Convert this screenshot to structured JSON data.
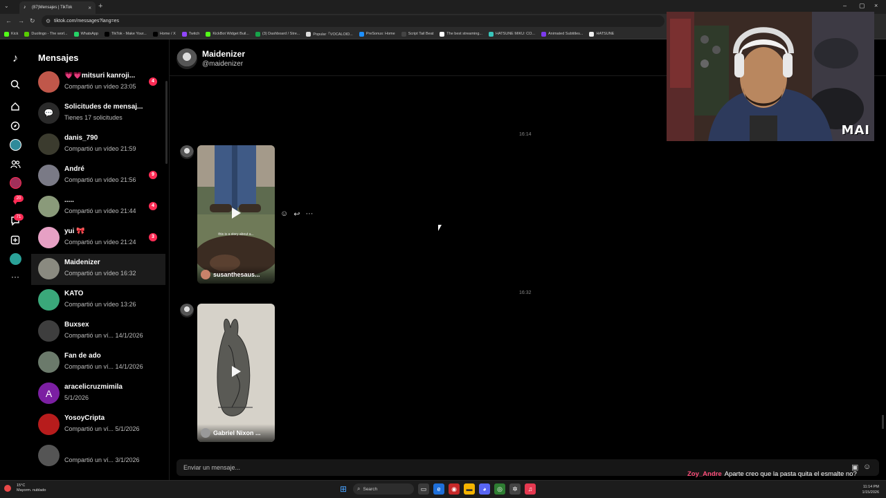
{
  "browser": {
    "tab_title": "(87)Mensajes | TikTok",
    "url": "tiktok.com/messages?lang=es",
    "bookmarks": [
      {
        "label": "Kick",
        "color": "#53fc18"
      },
      {
        "label": "Duolingo - The worl...",
        "color": "#58cc02"
      },
      {
        "label": "WhatsApp",
        "color": "#25d366"
      },
      {
        "label": "TikTok - Make Your...",
        "color": "#000000"
      },
      {
        "label": "Home / X",
        "color": "#000000"
      },
      {
        "label": "Twitch",
        "color": "#9146ff"
      },
      {
        "label": "KickBot Widget Buil...",
        "color": "#53fc18"
      },
      {
        "label": "(3) Dashboard / Stre...",
        "color": "#16a34a"
      },
      {
        "label": "Popular「VOCALOID...",
        "color": "#dddddd"
      },
      {
        "label": "PreSonus: Home",
        "color": "#1e90ff"
      },
      {
        "label": "Script Tail Beat",
        "color": "#444444"
      },
      {
        "label": "The best streaming...",
        "color": "#ffffff"
      },
      {
        "label": "HATSUNE MIKU: CO...",
        "color": "#39c5bb"
      },
      {
        "label": "Animated Subtitles...",
        "color": "#7c3aed"
      },
      {
        "label": "HATSUNE",
        "color": "#eeeeee"
      }
    ]
  },
  "rail": {
    "badges": {
      "heart": "20",
      "inbox": "71"
    }
  },
  "sidebar": {
    "title": "Mensajes",
    "conversations": [
      {
        "name": "💗💗mitsuri kanroji...",
        "sub": "Compartió un vídeo 23:05",
        "badge": "4",
        "color": "#c0574a"
      },
      {
        "name": "Solicitudes de mensaj...",
        "sub": "Tienes 17 solicitudes",
        "badge": "",
        "color": "#2a2a2a"
      },
      {
        "name": "danis_790",
        "sub": "Compartió un vídeo 21:59",
        "badge": "",
        "color": "#3b3b2e"
      },
      {
        "name": "André",
        "sub": "Compartió un vídeo 21:56",
        "badge": "9",
        "color": "#7a7a86"
      },
      {
        "name": ".....",
        "sub": "Compartió un vídeo 21:44",
        "badge": "4",
        "color": "#8a9a7a"
      },
      {
        "name": "yui 🎀",
        "sub": "Compartió un vídeo 21:24",
        "badge": "3",
        "color": "#e6a0c4"
      },
      {
        "name": "Maidenizer",
        "sub": "Compartió un vídeo 16:32",
        "badge": "",
        "color": "#8a8a80"
      },
      {
        "name": "KATO",
        "sub": "Compartió un vídeo 13:26",
        "badge": "",
        "color": "#3aa87a"
      },
      {
        "name": "Buxsex",
        "sub": "Compartió un ví... 14/1/2026",
        "badge": "",
        "color": "#3e3e3e"
      },
      {
        "name": "Fan de ado",
        "sub": "Compartió un ví... 14/1/2026",
        "badge": "",
        "color": "#6b7a6b"
      },
      {
        "name": "aracelicruzmimila",
        "sub": "5/1/2026",
        "badge": "",
        "color": "#7b1fa2",
        "initial": "A"
      },
      {
        "name": "YosoyCripta",
        "sub": "Compartió un ví... 5/1/2026",
        "badge": "",
        "color": "#b71c1c"
      },
      {
        "name": "",
        "sub": "Compartió un ví... 3/1/2026",
        "badge": "",
        "color": "#555555"
      }
    ]
  },
  "chat": {
    "name": "Maidenizer",
    "handle": "@maidenizer",
    "messages": [
      {
        "time": "16:14",
        "author": "susanthesaus...",
        "caption": "this is a story about a..."
      },
      {
        "time": "16:32",
        "author": "Gabriel Nixon ..."
      }
    ],
    "composer_placeholder": "Enviar un mensaje..."
  },
  "stream_chat": {
    "user": "Zoy_Andre",
    "text": "Aparte creo que la pasta quita el esmalte no?"
  },
  "webcam": {
    "logo": "MAI"
  },
  "taskbar": {
    "weather_temp": "15°C",
    "weather_desc": "Mayorm. nublado",
    "search_label": "Search",
    "time": "11:14 PM",
    "date": "1/15/2026"
  }
}
